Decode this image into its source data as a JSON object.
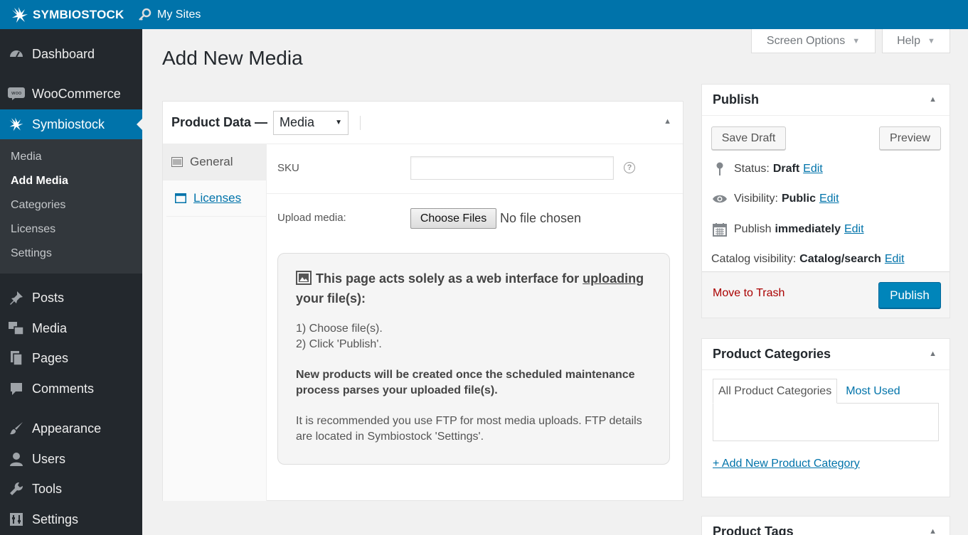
{
  "topbar": {
    "brand": "SYMBIOSTOCK",
    "my_sites": "My Sites"
  },
  "sidebar": {
    "items": [
      {
        "label": "Dashboard",
        "icon": "dashboard-icon"
      },
      {
        "label": "WooCommerce",
        "icon": "woocommerce-icon"
      },
      {
        "label": "Symbiostock",
        "icon": "symbiostock-icon"
      },
      {
        "label": "Posts",
        "icon": "pin-icon"
      },
      {
        "label": "Media",
        "icon": "media-icon"
      },
      {
        "label": "Pages",
        "icon": "pages-icon"
      },
      {
        "label": "Comments",
        "icon": "comment-icon"
      },
      {
        "label": "Appearance",
        "icon": "brush-icon"
      },
      {
        "label": "Users",
        "icon": "user-icon"
      },
      {
        "label": "Tools",
        "icon": "wrench-icon"
      },
      {
        "label": "Settings",
        "icon": "settings-icon"
      }
    ],
    "submenu": [
      "Media",
      "Add Media",
      "Categories",
      "Licenses",
      "Settings"
    ]
  },
  "header": {
    "page_title": "Add New Media",
    "screen_options": "Screen Options",
    "help": "Help"
  },
  "product_data": {
    "title": "Product Data —",
    "type_selected": "Media",
    "tabs": [
      "General",
      "Licenses"
    ],
    "sku_label": "SKU",
    "sku_value": "",
    "help_glyph": "?",
    "upload_label": "Upload media:",
    "choose_files": "Choose Files",
    "no_file": "No file chosen",
    "notice": {
      "heading_pre": "This page acts solely as a web interface for",
      "heading_link": "uploading",
      "heading_post": "your file(s):",
      "step1": "1) Choose file(s).",
      "step2": "2) Click 'Publish'.",
      "bold_text": "New products will be created once the scheduled maintenance process parses your uploaded file(s).",
      "ftp_text": "It is recommended you use FTP for most media uploads. FTP details are located in Symbiostock 'Settings'."
    }
  },
  "publish": {
    "title": "Publish",
    "save_draft": "Save Draft",
    "preview": "Preview",
    "status_label": "Status:",
    "status_value": "Draft",
    "visibility_label": "Visibility:",
    "visibility_value": "Public",
    "publish_label": "Publish",
    "publish_value": "immediately",
    "catalog_label": "Catalog visibility:",
    "catalog_value": "Catalog/search",
    "edit": "Edit",
    "move_to_trash": "Move to Trash",
    "publish_button": "Publish"
  },
  "categories": {
    "title": "Product Categories",
    "tab_all": "All Product Categories",
    "tab_most_used": "Most Used",
    "add_new": "+ Add New Product Category"
  },
  "tags": {
    "title": "Product Tags"
  },
  "colors": {
    "admin_bar": "#0073aa",
    "sidebar": "#23282d",
    "submenu": "#32373c",
    "primary_button": "#0085ba",
    "trash": "#a00"
  }
}
